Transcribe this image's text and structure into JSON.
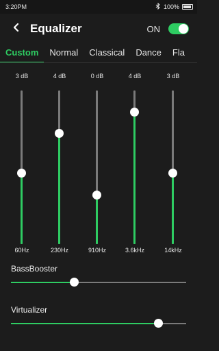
{
  "status": {
    "time": "3:20PM",
    "battery": "100%"
  },
  "header": {
    "title": "Equalizer",
    "on_label": "ON",
    "toggle_on": true
  },
  "tabs": [
    {
      "label": "Custom",
      "active": true
    },
    {
      "label": "Normal",
      "active": false
    },
    {
      "label": "Classical",
      "active": false
    },
    {
      "label": "Dance",
      "active": false
    },
    {
      "label": "Fla",
      "active": false
    }
  ],
  "bands": [
    {
      "value": "3 dB",
      "freq": "60Hz",
      "level": 0.46
    },
    {
      "value": "4 dB",
      "freq": "230Hz",
      "level": 0.72
    },
    {
      "value": "0 dB",
      "freq": "910Hz",
      "level": 0.32
    },
    {
      "value": "4 dB",
      "freq": "3.6kHz",
      "level": 0.86
    },
    {
      "value": "3 dB",
      "freq": "14kHz",
      "level": 0.46
    }
  ],
  "bass_booster": {
    "label": "BassBooster",
    "level": 0.36
  },
  "virtualizer": {
    "label": "Virtualizer",
    "level": 0.84
  },
  "colors": {
    "accent": "#2ecc62",
    "background": "#1c1c1c",
    "track": "#7a7a7a"
  }
}
